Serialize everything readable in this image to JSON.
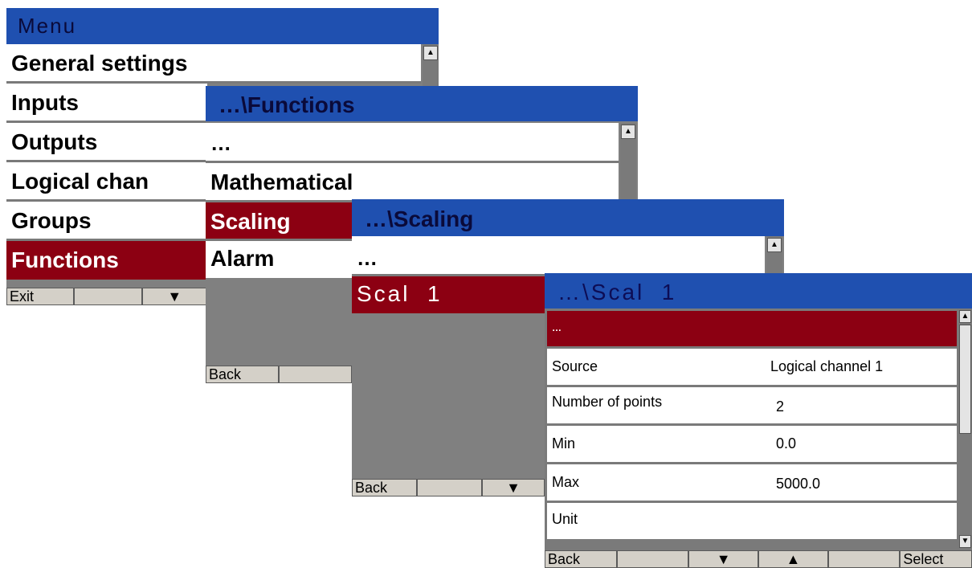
{
  "menu": {
    "title": "Menu",
    "items": [
      "General settings",
      "Inputs",
      "Outputs",
      "Logical chan",
      "Groups",
      "Functions"
    ],
    "footer": [
      "Exit",
      "",
      "▼"
    ]
  },
  "functions": {
    "title": "…\\Functions",
    "items": [
      "…",
      "Mathematical",
      "Scaling",
      "Alarm"
    ],
    "footer": [
      "Back",
      ""
    ]
  },
  "scaling": {
    "title": "…\\Scaling",
    "items": [
      "…",
      "Scal  1"
    ],
    "footer": [
      "Back",
      "",
      "▼"
    ]
  },
  "scal1": {
    "title": "…\\Scal  1",
    "top_item": "…",
    "fields": [
      {
        "label": "Source",
        "value": "Logical channel 1"
      },
      {
        "label": "Number of points",
        "value": "2"
      },
      {
        "label": "Min",
        "value": "0.0"
      },
      {
        "label": "Max",
        "value": "5000.0"
      },
      {
        "label": "Unit",
        "value": ""
      }
    ],
    "footer": [
      "Back",
      "",
      "▼",
      "▲",
      "",
      "Select"
    ]
  },
  "colors": {
    "title_bar": "#1f50b0",
    "selected": "#8c0012",
    "background": "#808080"
  }
}
